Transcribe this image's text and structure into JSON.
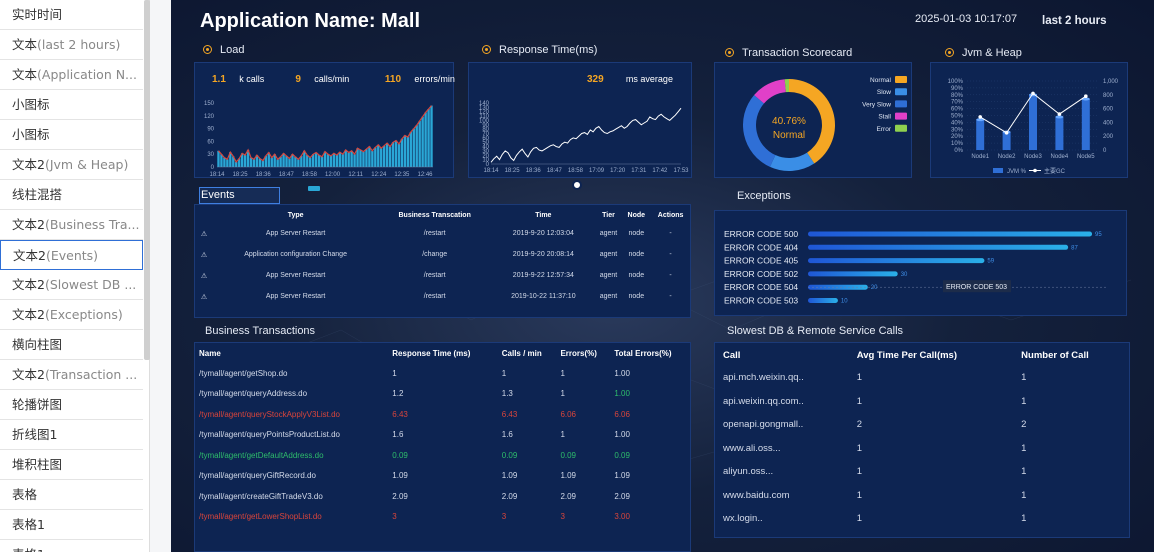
{
  "layers": [
    {
      "label": "实时时间",
      "sub": ""
    },
    {
      "label": "文本",
      "sub": "(last 2 hours)"
    },
    {
      "label": "文本",
      "sub": "(Application N..."
    },
    {
      "label": "小图标",
      "sub": ""
    },
    {
      "label": "小图标",
      "sub": ""
    },
    {
      "label": "文本2",
      "sub": "(Jvm & Heap)"
    },
    {
      "label": "线柱混搭",
      "sub": ""
    },
    {
      "label": "文本2",
      "sub": "(Business Tra..."
    },
    {
      "label": "文本2",
      "sub": "(Events)"
    },
    {
      "label": "文本2",
      "sub": "(Slowest DB ..."
    },
    {
      "label": "文本2",
      "sub": "(Exceptions)"
    },
    {
      "label": "横向柱图",
      "sub": ""
    },
    {
      "label": "文本2",
      "sub": "(Transaction ..."
    },
    {
      "label": "轮播饼图",
      "sub": ""
    },
    {
      "label": "折线图1",
      "sub": ""
    },
    {
      "label": "堆积柱图",
      "sub": ""
    },
    {
      "label": "表格",
      "sub": ""
    },
    {
      "label": "表格1",
      "sub": ""
    },
    {
      "label": "表格1",
      "sub": ""
    }
  ],
  "active_layer": 8,
  "header": {
    "app_title": "Application Name: Mall",
    "time": "2025-01-03 10:17:07",
    "range": "last 2 hours"
  },
  "panels": {
    "load": "Load",
    "response": "Response Time(ms)",
    "scorecard": "Transaction Scorecard",
    "jvm": "Jvm & Heap",
    "events": "Events",
    "exceptions": "Exceptions",
    "business": "Business Transactions",
    "slowest": "Slowest DB & Remote Service Calls"
  },
  "load_stats": {
    "kcalls": "1.1",
    "kcalls_label": "k calls",
    "cpm": "9",
    "cpm_label": "calls/min",
    "epm": "110",
    "epm_label": "errors/min"
  },
  "response_stats": {
    "avg": "329",
    "avg_label": "ms average"
  },
  "colors": {
    "accent": "#f5a623",
    "panel": "#0d2452",
    "bar": "#2aa7d6",
    "error_line": "#d9453b",
    "red": "#d9453b",
    "green": "#2ebd6b"
  },
  "chart_data": [
    {
      "type": "bar",
      "title": "Load",
      "x_ticks": [
        "18:14",
        "18:25",
        "18:36",
        "18:47",
        "18:58",
        "12:00",
        "12:11",
        "12:24",
        "12:35",
        "12:46"
      ],
      "y_ticks": [
        "0",
        "30",
        "60",
        "90",
        "120",
        "150"
      ],
      "ylim": [
        0,
        150
      ],
      "values": [
        38,
        30,
        22,
        18,
        35,
        25,
        12,
        20,
        32,
        28,
        40,
        22,
        18,
        28,
        20,
        15,
        26,
        34,
        22,
        30,
        18,
        24,
        32,
        26,
        20,
        30,
        24,
        18,
        26,
        38,
        28,
        22,
        30,
        34,
        28,
        24,
        36,
        30,
        26,
        32,
        28,
        35,
        30,
        40,
        34,
        38,
        30,
        44,
        40,
        36,
        42,
        48,
        38,
        46,
        52,
        44,
        50,
        56,
        48,
        58,
        62,
        54,
        66,
        74,
        70,
        82,
        90,
        98,
        108,
        118,
        128,
        136,
        144
      ]
    },
    {
      "type": "line",
      "title": "Response Time(ms)",
      "x_ticks": [
        "18:14",
        "18:25",
        "18:36",
        "18:47",
        "18:58",
        "17:09",
        "17:20",
        "17:31",
        "17:42",
        "17:53"
      ],
      "y_ticks": [
        "0",
        "10",
        "20",
        "30",
        "40",
        "50",
        "60",
        "70",
        "80",
        "90",
        "100",
        "110",
        "120",
        "130",
        "140"
      ],
      "ylim": [
        0,
        140
      ],
      "values": [
        4,
        12,
        18,
        10,
        22,
        30,
        26,
        14,
        8,
        20,
        28,
        34,
        24,
        16,
        28,
        36,
        38,
        32,
        30,
        34,
        38,
        42,
        44,
        40,
        38,
        46,
        50,
        48,
        56,
        60,
        58,
        64,
        70,
        72,
        68,
        78,
        74,
        82,
        86,
        78,
        72,
        70,
        74,
        76,
        80,
        84,
        88,
        82,
        86,
        94,
        100,
        102,
        96,
        90,
        94,
        98,
        108,
        104,
        102,
        110,
        114,
        108,
        104,
        100,
        106,
        112,
        120,
        128
      ]
    },
    {
      "type": "pie",
      "title": "Transaction Scorecard",
      "center_value": "40.76%",
      "center_label": "Normal",
      "slices": [
        {
          "name": "Normal",
          "value": 40.76,
          "color": "#f5a623"
        },
        {
          "name": "Slow",
          "value": 16.0,
          "color": "#3a8ee6"
        },
        {
          "name": "Very Slow",
          "value": 29.5,
          "color": "#2f6fd6"
        },
        {
          "name": "Stall",
          "value": 12.2,
          "color": "#e040c8"
        },
        {
          "name": "Error",
          "value": 1.5,
          "color": "#8fd14f"
        }
      ]
    },
    {
      "type": "bar",
      "title": "Jvm & Heap",
      "categories": [
        "Node1",
        "Node2",
        "Node3",
        "Node4",
        "Node5"
      ],
      "y_left_ticks": [
        "0%",
        "10%",
        "20%",
        "30%",
        "40%",
        "50%",
        "60%",
        "70%",
        "80%",
        "90%",
        "100%"
      ],
      "y_right_ticks": [
        "0",
        "200",
        "400",
        "600",
        "800",
        "1,000"
      ],
      "series": [
        {
          "name": "JVM %",
          "values": [
            44,
            26,
            80,
            48,
            74
          ]
        },
        {
          "name": "主要GC",
          "values": [
            480,
            250,
            820,
            520,
            780
          ]
        }
      ]
    },
    {
      "type": "bar",
      "title": "Exceptions",
      "categories": [
        "ERROR CODE 500",
        "ERROR CODE 404",
        "ERROR CODE 405",
        "ERROR CODE 502",
        "ERROR CODE 504",
        "ERROR CODE 503"
      ],
      "values": [
        95,
        87,
        59,
        30,
        20,
        10
      ],
      "xlim": [
        0,
        100
      ],
      "tooltip": "ERROR CODE 503"
    }
  ],
  "events": {
    "headers": [
      "",
      "Type",
      "Business Transcation",
      "Time",
      "Tier",
      "Node",
      "Actions"
    ],
    "rows": [
      [
        "⚠",
        "App Server Restart",
        "/restart",
        "2019-9-20 12:03:04",
        "agent",
        "node",
        "-"
      ],
      [
        "⚠",
        "Application configuration Change",
        "/change",
        "2019-9-20 20:08:14",
        "agent",
        "node",
        "-"
      ],
      [
        "⚠",
        "App Server Restart",
        "/restart",
        "2019-9-22 12:57:34",
        "agent",
        "node",
        "-"
      ],
      [
        "⚠",
        "App Server Restart",
        "/restart",
        "2019-10-22 11:37:10",
        "agent",
        "node",
        "-"
      ]
    ]
  },
  "business": {
    "headers": [
      "Name",
      "Response Time (ms)",
      "Calls / min",
      "Errors(%)",
      "Total Errors(%)"
    ],
    "rows": [
      {
        "cells": [
          "/tymall/agent/getShop.do",
          "1",
          "1",
          "1",
          "1.00"
        ],
        "style": ""
      },
      {
        "cells": [
          "/tymall/agent/queryAddress.do",
          "1.2",
          "1.3",
          "1",
          "1.00"
        ],
        "style": "last-green"
      },
      {
        "cells": [
          "/tymall/agent/queryStockApplyV3List.do",
          "6.43",
          "6.43",
          "6.06",
          "6.06"
        ],
        "style": "red"
      },
      {
        "cells": [
          "/tymall/agent/queryPointsProductList.do",
          "1.6",
          "1.6",
          "1",
          "1.00"
        ],
        "style": ""
      },
      {
        "cells": [
          "/tymall/agent/getDefaultAddress.do",
          "0.09",
          "0.09",
          "0.09",
          "0.09"
        ],
        "style": "green"
      },
      {
        "cells": [
          "/tymall/agent/queryGiftRecord.do",
          "1.09",
          "1.09",
          "1.09",
          "1.09"
        ],
        "style": ""
      },
      {
        "cells": [
          "/tymall/agent/createGiftTradeV3.do",
          "2.09",
          "2.09",
          "2.09",
          "2.09"
        ],
        "style": ""
      },
      {
        "cells": [
          "/tymall/agent/getLowerShopList.do",
          "3",
          "3",
          "3",
          "3.00"
        ],
        "style": "red"
      }
    ]
  },
  "slowest": {
    "headers": [
      "Call",
      "Avg Time Per Call(ms)",
      "Number of Call"
    ],
    "rows": [
      [
        "api.mch.weixin.qq..",
        "1",
        "1"
      ],
      [
        "api.weixin.qq.com..",
        "1",
        "1"
      ],
      [
        "openapi.gongmall..",
        "2",
        "2"
      ],
      [
        "www.ali.oss...",
        "1",
        "1"
      ],
      [
        "aliyun.oss...",
        "1",
        "1"
      ],
      [
        "www.baidu.com",
        "1",
        "1"
      ],
      [
        "wx.login..",
        "1",
        "1"
      ]
    ]
  }
}
